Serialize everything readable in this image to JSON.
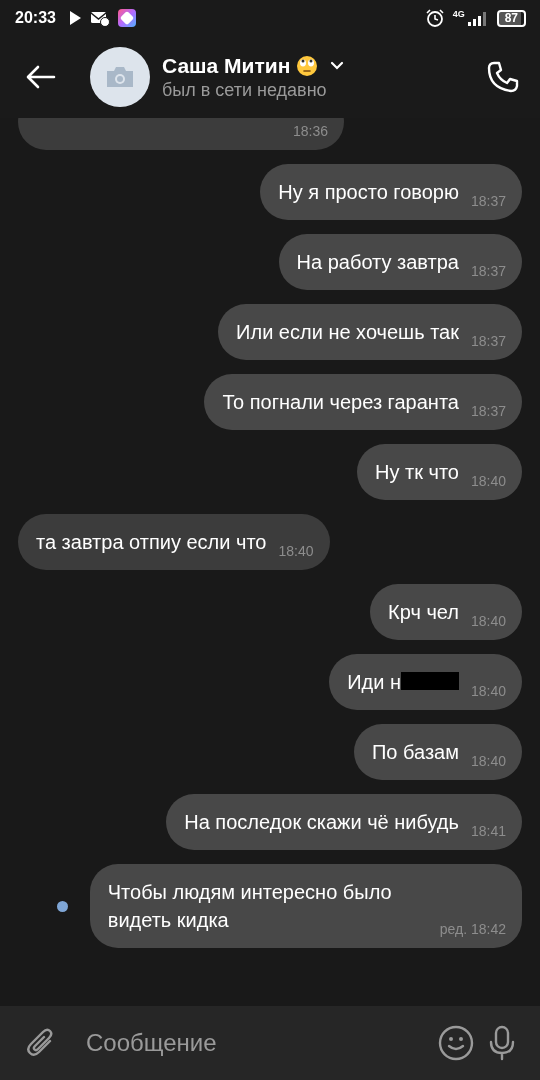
{
  "status_bar": {
    "time": "20:33",
    "network": "4G",
    "battery": "87"
  },
  "header": {
    "name": "Саша Митин",
    "status": "был в сети недавно"
  },
  "messages": [
    {
      "time": "18:36",
      "outgoing": false
    },
    {
      "text": "Ну я просто говорю",
      "time": "18:37",
      "outgoing": true
    },
    {
      "text": "На работу завтра",
      "time": "18:37",
      "outgoing": true
    },
    {
      "text": "Или если не хочешь так",
      "time": "18:37",
      "outgoing": true
    },
    {
      "text": "То погнали через гаранта",
      "time": "18:37",
      "outgoing": true
    },
    {
      "text": "Ну тк что",
      "time": "18:40",
      "outgoing": true
    },
    {
      "text": "та завтра отпиу если что",
      "time": "18:40",
      "outgoing": false
    },
    {
      "text": "Крч чел",
      "time": "18:40",
      "outgoing": true
    },
    {
      "text": "Иди н",
      "time": "18:40",
      "outgoing": true,
      "redacted": true
    },
    {
      "text": "По базам",
      "time": "18:40",
      "outgoing": true
    },
    {
      "text": "На последок скажи чё нибудь",
      "time": "18:41",
      "outgoing": true
    },
    {
      "text": "Чтобы людям интересно было видеть кидка",
      "time": "ред. 18:42",
      "outgoing": true,
      "unread": true
    }
  ],
  "composer": {
    "placeholder": "Сообщение"
  }
}
